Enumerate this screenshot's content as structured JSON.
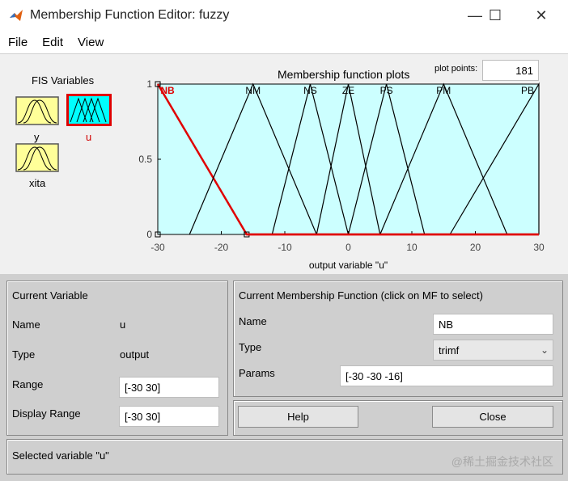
{
  "window": {
    "title": "Membership Function Editor: fuzzy",
    "controls": {
      "minimize": "—",
      "maximize": "☐",
      "close": "✕"
    }
  },
  "menu": [
    "File",
    "Edit",
    "View"
  ],
  "fis_variables": {
    "title": "FIS Variables",
    "inputs": [
      {
        "label": "y"
      },
      {
        "label": "xita"
      }
    ],
    "outputs": [
      {
        "label": "u",
        "selected": true
      }
    ],
    "colors": {
      "input": "#ffff99",
      "output": "#00ffff",
      "selected_border": "#e00000",
      "selected_label": "#d00000"
    }
  },
  "plot": {
    "title": "Membership function plots",
    "plot_points_label": "plot points:",
    "plot_points_value": "181",
    "background": "#ccffff",
    "xlabel": "output variable \"u\"",
    "x_ticks": [
      "-30",
      "-20",
      "-10",
      "0",
      "10",
      "20",
      "30"
    ],
    "y_ticks": [
      "0",
      "0.5",
      "1"
    ]
  },
  "chart_data": {
    "type": "line",
    "title": "Membership function plots",
    "xlabel": "output variable \"u\"",
    "ylabel": "",
    "xlim": [
      -30,
      30
    ],
    "ylim": [
      0,
      1
    ],
    "series": [
      {
        "name": "NB",
        "params": [
          -30,
          -30,
          -16
        ],
        "selected": true
      },
      {
        "name": "NM",
        "params": [
          -25,
          -15,
          -5
        ]
      },
      {
        "name": "NS",
        "params": [
          -12,
          -6,
          0
        ]
      },
      {
        "name": "ZE",
        "params": [
          -5,
          0,
          5
        ]
      },
      {
        "name": "PS",
        "params": [
          0,
          6,
          12
        ]
      },
      {
        "name": "PM",
        "params": [
          5,
          15,
          25
        ]
      },
      {
        "name": "PB",
        "params": [
          16,
          30,
          30
        ]
      }
    ],
    "colors": {
      "selected": "#e00000",
      "normal": "#000000"
    }
  },
  "current_variable": {
    "title": "Current Variable",
    "name_label": "Name",
    "name_value": "u",
    "type_label": "Type",
    "type_value": "output",
    "range_label": "Range",
    "range_value": "[-30 30]",
    "display_range_label": "Display Range",
    "display_range_value": "[-30 30]"
  },
  "current_mf": {
    "title": "Current Membership Function (click on MF to select)",
    "name_label": "Name",
    "name_value": "NB",
    "type_label": "Type",
    "type_value": "trimf",
    "params_label": "Params",
    "params_value": "[-30 -30 -16]"
  },
  "buttons": {
    "help": "Help",
    "close": "Close"
  },
  "status": "Selected variable \"u\"",
  "watermark": "@稀土掘金技术社区"
}
